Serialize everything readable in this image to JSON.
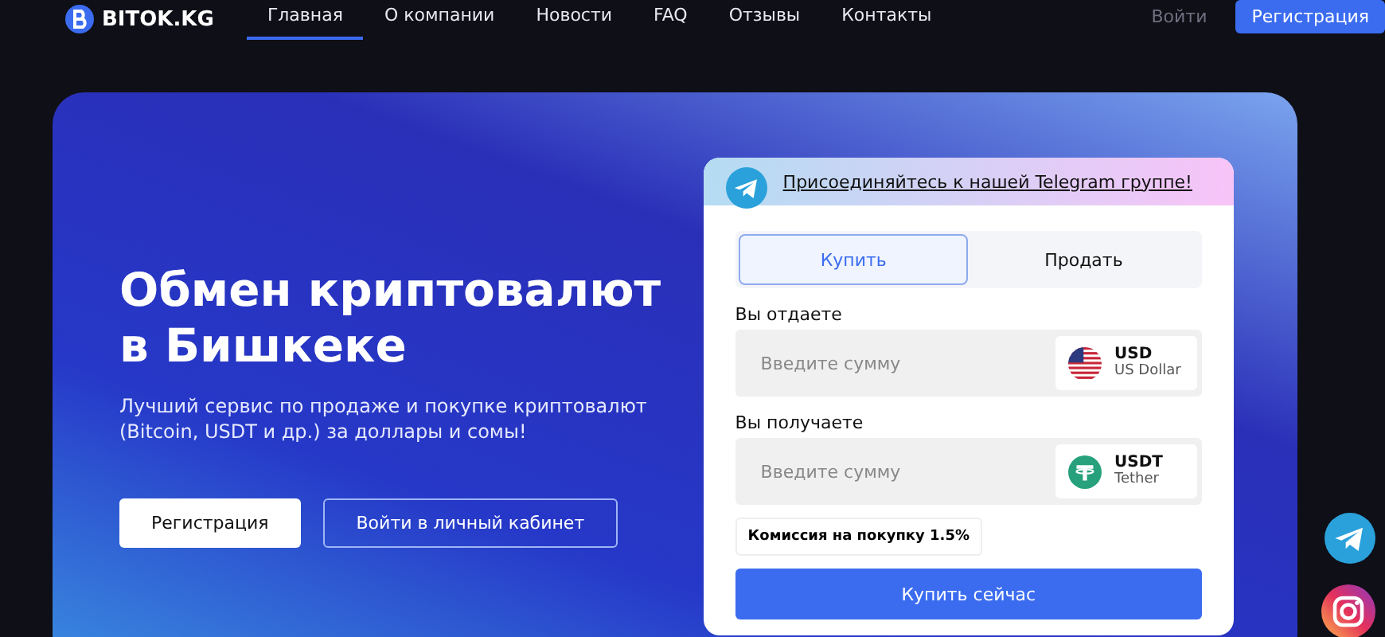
{
  "header": {
    "logo": "BITOK.KG",
    "nav": [
      {
        "label": "Главная",
        "selected": true
      },
      {
        "label": "О компании",
        "selected": false
      },
      {
        "label": "Новости",
        "selected": false
      },
      {
        "label": "FAQ",
        "selected": false
      },
      {
        "label": "Отзывы",
        "selected": false
      },
      {
        "label": "Контакты",
        "selected": false
      }
    ],
    "login": "Войти",
    "register": "Регистрация"
  },
  "hero": {
    "title": "Обмен криптовалют в Бишкеке",
    "subtitle": "Лучший сервис по продаже и покупке криптовалют (Bitcoin, USDT и др.) за доллары и сомы!",
    "buttons": [
      "Регистрация",
      "Войти в личный кабинет"
    ]
  },
  "exchange": {
    "telegram_link": "Присоединяйтесь к нашей Telegram группе!",
    "tabs": [
      {
        "label": "Купить",
        "selected": true
      },
      {
        "label": "Продать",
        "selected": false
      }
    ],
    "fields": [
      {
        "label": "Вы отдаете",
        "placeholder": "Введите сумму",
        "code": "USD",
        "name": "US Dollar",
        "kind": "flag"
      },
      {
        "label": "Вы получаете",
        "placeholder": "Введите сумму",
        "code": "USDT",
        "name": "Tether",
        "kind": "tether"
      }
    ],
    "commission": "Комиссия на покупку 1.5%",
    "submit": "Купить сейчас"
  }
}
